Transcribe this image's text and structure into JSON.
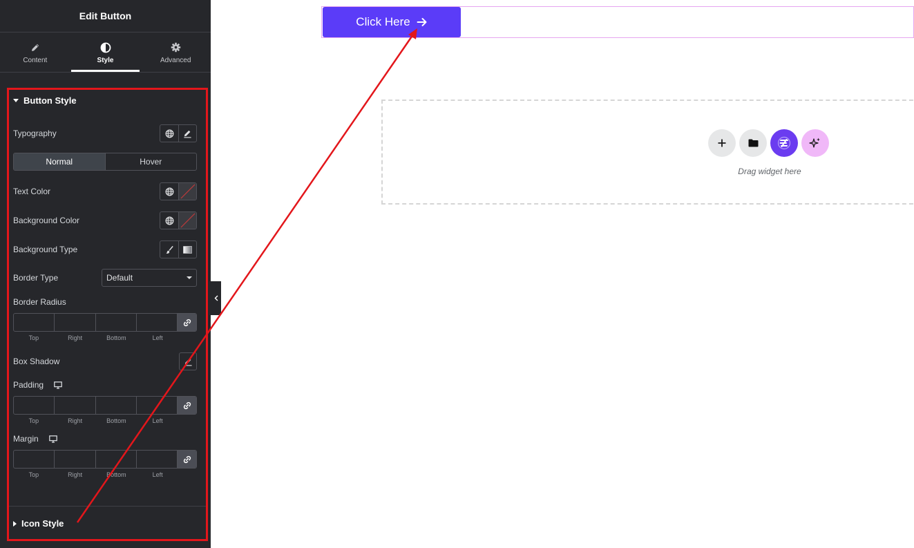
{
  "panel": {
    "title": "Edit Button",
    "tabs": [
      {
        "label": "Content",
        "icon": "pencil-icon",
        "active": false
      },
      {
        "label": "Style",
        "icon": "contrast-icon",
        "active": true
      },
      {
        "label": "Advanced",
        "icon": "gear-icon",
        "active": false
      }
    ]
  },
  "button_style": {
    "title": "Button Style",
    "typography_label": "Typography",
    "state_tabs": {
      "normal": "Normal",
      "hover": "Hover",
      "active": "Normal"
    },
    "text_color_label": "Text Color",
    "background_color_label": "Background Color",
    "background_type_label": "Background Type",
    "border_type": {
      "label": "Border Type",
      "value": "Default"
    },
    "border_radius": {
      "label": "Border Radius",
      "top": "Top",
      "right": "Right",
      "bottom": "Bottom",
      "left": "Left"
    },
    "box_shadow_label": "Box Shadow",
    "padding": {
      "label": "Padding",
      "top": "Top",
      "right": "Right",
      "bottom": "Bottom",
      "left": "Left"
    },
    "margin": {
      "label": "Margin",
      "top": "Top",
      "right": "Right",
      "bottom": "Bottom",
      "left": "Left"
    }
  },
  "icon_style": {
    "title": "Icon Style"
  },
  "canvas": {
    "button_label": "Click Here",
    "button_color": "#5b3cf8",
    "drop_zone_text": "Drag widget here",
    "drop_icons": [
      "plus-icon",
      "folder-icon",
      "template-kit-icon",
      "ai-sparkle-icon"
    ]
  },
  "annotation": {
    "color": "#e3161b"
  }
}
